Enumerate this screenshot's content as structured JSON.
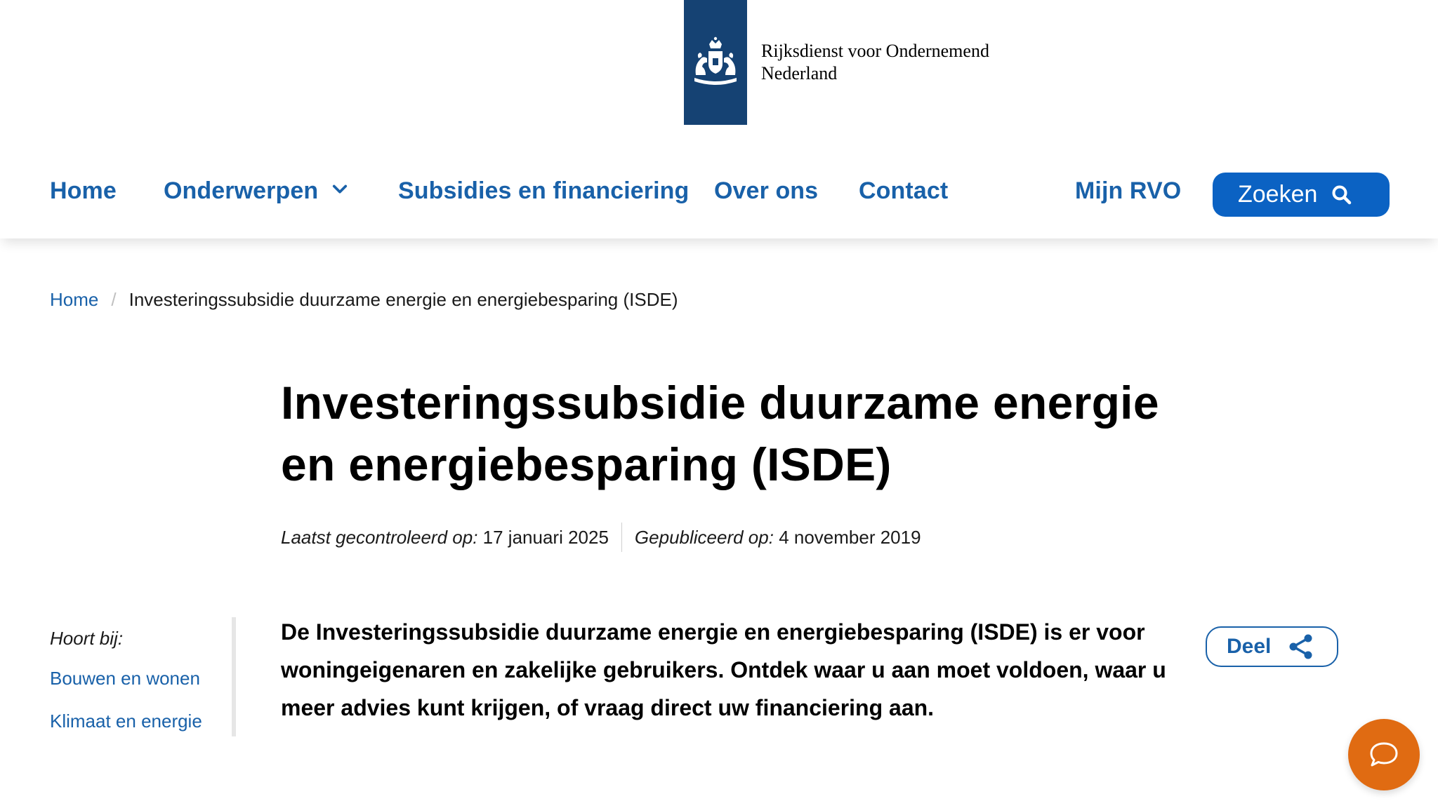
{
  "header": {
    "logo_line1": "Rijksdienst voor Ondernemend",
    "logo_line2": "Nederland",
    "logo_icon": "coat-of-arms-icon"
  },
  "nav": {
    "items": [
      {
        "label": "Home"
      },
      {
        "label": "Onderwerpen",
        "icon": "chevron-down-icon"
      },
      {
        "label": "Subsidies en financiering"
      },
      {
        "label": "Over ons"
      },
      {
        "label": "Contact"
      },
      {
        "label": "Mijn RVO"
      }
    ],
    "search_label": "Zoeken",
    "search_icon": "search-icon"
  },
  "breadcrumb": {
    "home": "Home",
    "separator": "/",
    "current": "Investeringssubsidie duurzame energie en energiebesparing (ISDE)"
  },
  "page": {
    "title": "Investeringssubsidie duurzame energie en energiebesparing (ISDE)",
    "checked_label": "Laatst gecontroleerd op:",
    "checked_date": "17 januari 2025",
    "published_label": "Gepubliceerd op:",
    "published_date": "4 november 2019",
    "intro": "De Investeringssubsidie duurzame energie en energiebesparing (ISDE) is er voor woningeigenaren en zakelijke gebruikers. Ontdek waar u aan moet voldoen, waar u meer advies kunt krijgen, of vraag direct uw financiering aan."
  },
  "side": {
    "label": "Hoort bij:",
    "links": [
      "Bouwen en wonen",
      "Klimaat en energie"
    ]
  },
  "share": {
    "label": "Deel",
    "icon": "share-icon"
  },
  "chat": {
    "icon": "chat-bubble-icon"
  },
  "colors": {
    "brand_blue": "#154273",
    "link_blue": "#1961a9",
    "button_blue": "#0b62c3",
    "chat_orange": "#e06b12"
  }
}
